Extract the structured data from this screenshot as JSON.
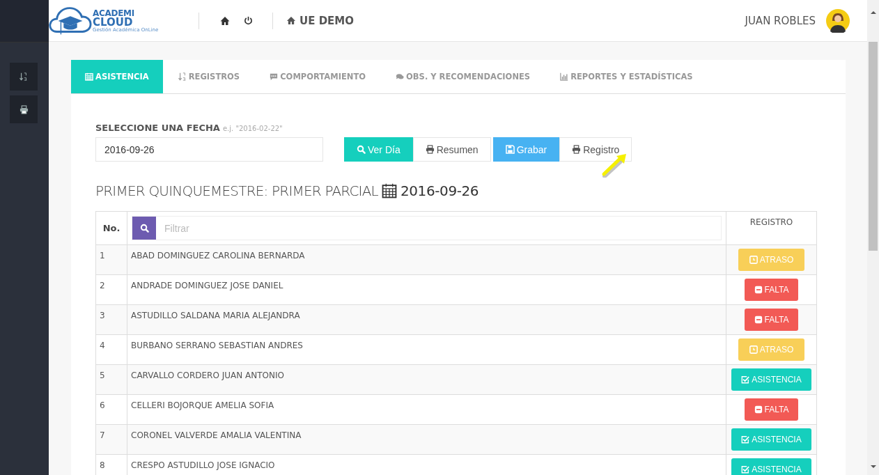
{
  "logo": {
    "line1": "ACADEMI",
    "line2": "CLOUD",
    "tagline": "Gestión Académica OnLine"
  },
  "header": {
    "school": "UE DEMO",
    "user": "JUAN ROBLES"
  },
  "tabs": [
    {
      "label": "ASISTENCIA",
      "selected": true
    },
    {
      "label": "REGISTROS",
      "selected": false
    },
    {
      "label": "COMPORTAMIENTO",
      "selected": false
    },
    {
      "label": "OBS. Y RECOMENDACIONES",
      "selected": false
    },
    {
      "label": "REPORTES Y ESTADÍSTICAS",
      "selected": false
    }
  ],
  "date_form": {
    "label": "SELECCIONE UNA FECHA",
    "hint": "e.j. \"2016-02-22\"",
    "value": "2016-09-26"
  },
  "buttons": [
    {
      "label": "Ver Día",
      "kind": "primary"
    },
    {
      "label": "Resumen",
      "kind": "default"
    },
    {
      "label": "Grabar",
      "kind": "info"
    },
    {
      "label": "Registro",
      "kind": "default"
    }
  ],
  "period_title": "PRIMER QUINQUEMESTRE: PRIMER PARCIAL",
  "period_date": "2016-09-26",
  "table": {
    "columns": [
      "No.",
      "REGISTRO"
    ],
    "filter_placeholder": "Filtrar",
    "rows": [
      {
        "no": "1",
        "name": "ABAD DOMINGUEZ CAROLINA BERNARDA",
        "kind": "atraso",
        "status": "ATRASO"
      },
      {
        "no": "2",
        "name": "ANDRADE DOMINGUEZ JOSE DANIEL",
        "kind": "falta",
        "status": "FALTA"
      },
      {
        "no": "3",
        "name": "ASTUDILLO SALDANA MARIA ALEJANDRA",
        "kind": "falta",
        "status": "FALTA"
      },
      {
        "no": "4",
        "name": "BURBANO SERRANO SEBASTIAN ANDRES",
        "kind": "atraso",
        "status": "ATRASO"
      },
      {
        "no": "5",
        "name": "CARVALLO CORDERO JUAN ANTONIO",
        "kind": "asistencia",
        "status": "ASISTENCIA"
      },
      {
        "no": "6",
        "name": "CELLERI BOJORQUE AMELIA SOFIA",
        "kind": "falta",
        "status": "FALTA"
      },
      {
        "no": "7",
        "name": "CORONEL VALVERDE AMALIA VALENTINA",
        "kind": "asistencia",
        "status": "ASISTENCIA"
      },
      {
        "no": "8",
        "name": "CRESPO ASTUDILLO JOSE IGNACIO",
        "kind": "asistencia",
        "status": "ASISTENCIA"
      }
    ]
  }
}
